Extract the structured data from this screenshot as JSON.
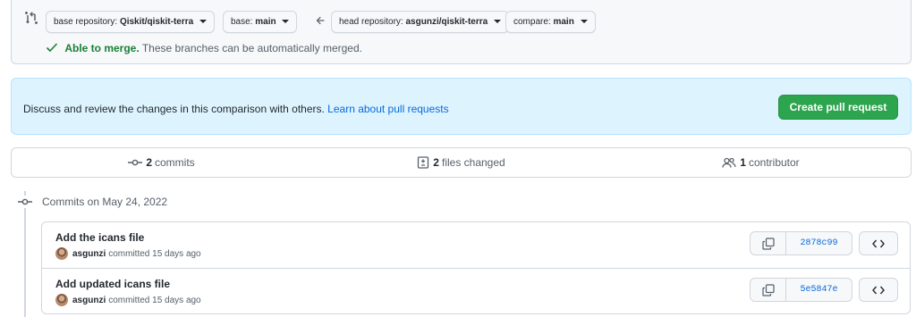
{
  "range": {
    "base_repository": {
      "prefix": "base repository:",
      "value": "Qiskit/qiskit-terra"
    },
    "base": {
      "prefix": "base:",
      "value": "main"
    },
    "head_repository": {
      "prefix": "head repository:",
      "value": "asgunzi/qiskit-terra"
    },
    "compare": {
      "prefix": "compare:",
      "value": "main"
    },
    "merge_status": "Able to merge.",
    "merge_message": "These branches can be automatically merged."
  },
  "flash": {
    "text": "Discuss and review the changes in this comparison with others.",
    "link": "Learn about pull requests",
    "button": "Create pull request"
  },
  "stats": {
    "commits_count": "2",
    "commits_label": "commits",
    "files_count": "2",
    "files_label": "files changed",
    "contributors_count": "1",
    "contributors_label": "contributor"
  },
  "timeline": {
    "date_heading": "Commits on May 24, 2022"
  },
  "commits": [
    {
      "title": "Add the icans file",
      "author": "asgunzi",
      "action": "committed 15 days ago",
      "sha": "2878c99"
    },
    {
      "title": "Add updated icans file",
      "author": "asgunzi",
      "action": "committed 15 days ago",
      "sha": "5e5847e"
    }
  ],
  "colors": {
    "merge_ok": "#1a7f37",
    "link": "#0969da",
    "primary_button": "#2da44e",
    "flash_bg": "#ddf4ff"
  },
  "icons": [
    "git-compare-icon",
    "arrow-left-icon",
    "check-icon",
    "git-commit-icon",
    "file-diff-icon",
    "people-icon",
    "copy-icon",
    "code-icon"
  ]
}
